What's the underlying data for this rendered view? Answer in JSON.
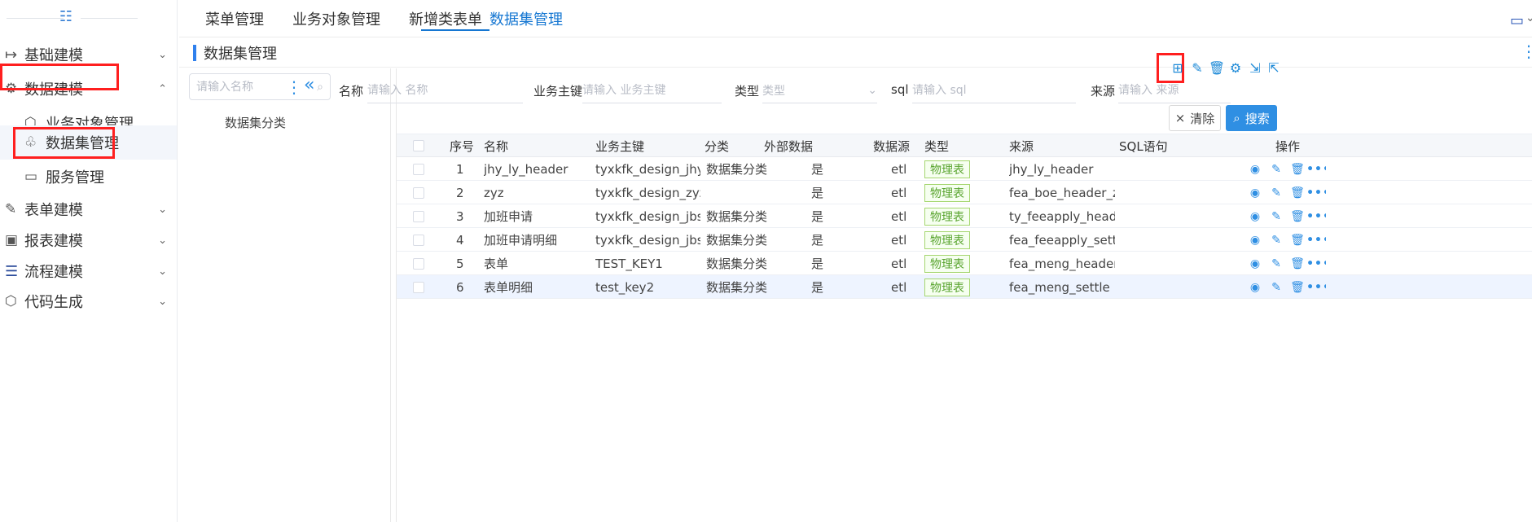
{
  "sidebar": {
    "menu": [
      {
        "label": "基础建模",
        "icon": "logout-icon",
        "expanded": false
      },
      {
        "label": "数据建模",
        "icon": "settings-icon",
        "expanded": true
      },
      {
        "label": "表单建模",
        "icon": "edit-icon",
        "expanded": false
      },
      {
        "label": "报表建模",
        "icon": "report-icon",
        "expanded": false
      },
      {
        "label": "流程建模",
        "icon": "list-icon",
        "expanded": false
      },
      {
        "label": "代码生成",
        "icon": "cube-icon",
        "expanded": false
      }
    ],
    "submenu": [
      {
        "label": "业务对象管理",
        "icon": "cube-icon"
      },
      {
        "label": "数据集管理",
        "icon": "hierarchy-icon",
        "selected": true
      },
      {
        "label": "服务管理",
        "icon": "drive-icon"
      }
    ]
  },
  "topbar": {
    "tabs": [
      "菜单管理",
      "业务对象管理",
      "新增类表单",
      "数据集管理"
    ],
    "active_tab": "数据集管理"
  },
  "page": {
    "title": "数据集管理"
  },
  "tree": {
    "search_placeholder": "请输入名称",
    "node": "数据集分类"
  },
  "filters": {
    "name_label": "名称",
    "name_placeholder": "请输入 名称",
    "key_label": "业务主键",
    "key_placeholder": "请输入 业务主键",
    "type_label": "类型",
    "type_placeholder": "类型",
    "sql_label": "sql",
    "sql_placeholder": "请输入 sql",
    "source_label": "来源",
    "source_placeholder": "请输入 来源"
  },
  "buttons": {
    "clear": "清除",
    "search": "搜索"
  },
  "table": {
    "headers": [
      "序号",
      "名称",
      "业务主键",
      "分类",
      "外部数据",
      "数据源",
      "类型",
      "来源",
      "SQL语句",
      "操作"
    ],
    "rows": [
      {
        "index": "1",
        "name": "jhy_ly_header",
        "key": "tyxkfk_design_jhy_l...",
        "category": "数据集分类",
        "external": "是",
        "datasource": "etl",
        "type": "物理表",
        "source": "jhy_ly_header",
        "sql": ""
      },
      {
        "index": "2",
        "name": "zyz",
        "key": "tyxkfk_design_zyz",
        "category": "",
        "external": "是",
        "datasource": "etl",
        "type": "物理表",
        "source": "fea_boe_header_zyz",
        "sql": ""
      },
      {
        "index": "3",
        "name": "加班申请",
        "key": "tyxkfk_design_jbsq",
        "category": "数据集分类",
        "external": "是",
        "datasource": "etl",
        "type": "物理表",
        "source": "ty_feeapply_header",
        "sql": ""
      },
      {
        "index": "4",
        "name": "加班申请明细",
        "key": "tyxkfk_design_jbsqmx",
        "category": "数据集分类",
        "external": "是",
        "datasource": "etl",
        "type": "物理表",
        "source": "fea_feeapply_settle",
        "sql": ""
      },
      {
        "index": "5",
        "name": "表单",
        "key": "TEST_KEY1",
        "category": "数据集分类",
        "external": "是",
        "datasource": "etl",
        "type": "物理表",
        "source": "fea_meng_header",
        "sql": ""
      },
      {
        "index": "6",
        "name": "表单明细",
        "key": "test_key2",
        "category": "数据集分类",
        "external": "是",
        "datasource": "etl",
        "type": "物理表",
        "source": "fea_meng_settle",
        "sql": ""
      }
    ]
  },
  "icons": {
    "menu_toggle": "☷",
    "chevron_down": "⌄",
    "chevron_up": "⌃",
    "logout": "↦",
    "settings": "⚙",
    "cube": "⬡",
    "hierarchy": "♧",
    "drive": "▭",
    "edit": "✎",
    "report": "▣",
    "list": "☰",
    "search": "⌕",
    "more_vertical": "⋮",
    "collapse": "«",
    "add": "⊞",
    "delete": "🗑",
    "import": "⇲",
    "export": "⇱",
    "view": "◉",
    "more_horizontal": "•••",
    "monitor": "▭",
    "close": "×"
  },
  "colors": {
    "accent": "#1677d2",
    "highlight": "#ff1f1f",
    "tag_border": "#a5d66f",
    "tag_text": "#5aa530"
  }
}
